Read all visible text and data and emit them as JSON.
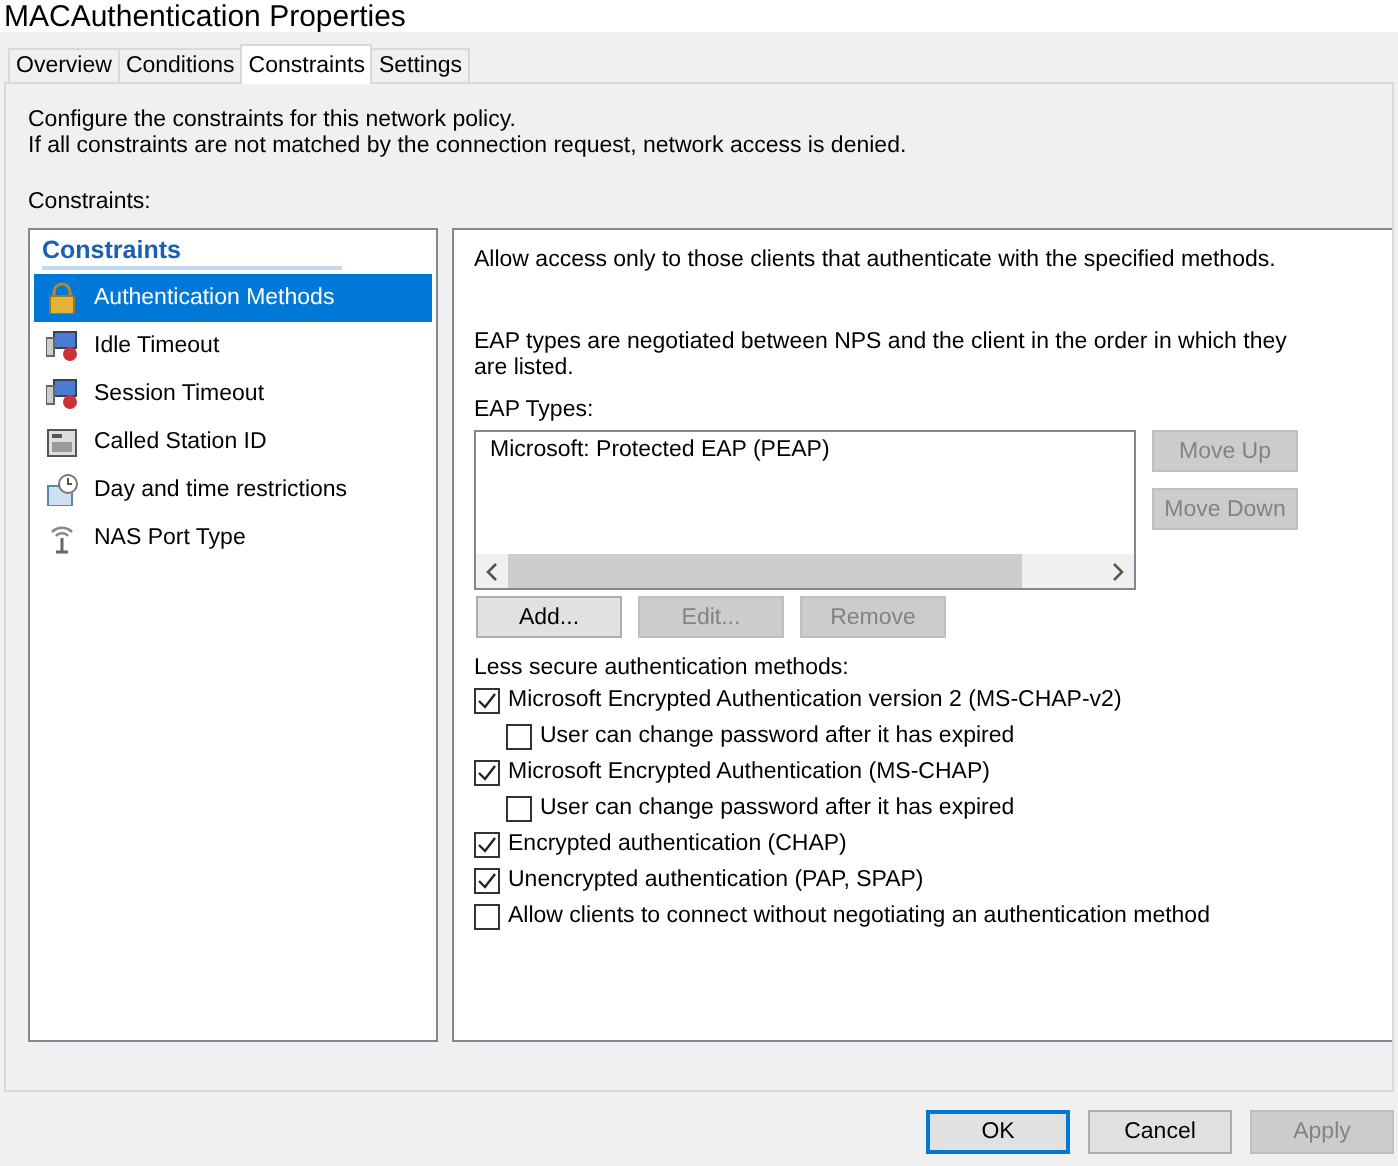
{
  "window": {
    "title": "MACAuthentication Properties"
  },
  "tabs": [
    {
      "label": "Overview",
      "selected": false
    },
    {
      "label": "Conditions",
      "selected": false
    },
    {
      "label": "Constraints",
      "selected": true
    },
    {
      "label": "Settings",
      "selected": false
    }
  ],
  "intro": [
    "Configure the constraints for this network policy.",
    "If all constraints are not matched by the connection request, network access is denied."
  ],
  "constraints_label": "Constraints:",
  "sidebar": {
    "heading": "Constraints",
    "items": [
      {
        "label": "Authentication Methods",
        "selected": true
      },
      {
        "label": "Idle Timeout",
        "selected": false
      },
      {
        "label": "Session Timeout",
        "selected": false
      },
      {
        "label": "Called Station ID",
        "selected": false
      },
      {
        "label": "Day and time restrictions",
        "selected": false
      },
      {
        "label": "NAS Port Type",
        "selected": false
      }
    ]
  },
  "panel": {
    "description": "Allow access only to those clients that authenticate with the specified methods.",
    "eap_note": "EAP types are negotiated between NPS and the client in the order in which they are listed.",
    "eap_label": "EAP Types:",
    "eap_types": [
      "Microsoft: Protected EAP (PEAP)"
    ],
    "side_buttons": [
      {
        "label": "Move Up",
        "disabled": true
      },
      {
        "label": "Move Down",
        "disabled": true
      }
    ],
    "eap_buttons": [
      {
        "label": "Add...",
        "disabled": false
      },
      {
        "label": "Edit...",
        "disabled": true
      },
      {
        "label": "Remove",
        "disabled": true
      }
    ],
    "methods_label": "Less secure authentication methods:",
    "methods": [
      {
        "label": "Microsoft Encrypted Authentication version 2 (MS-CHAP-v2)",
        "checked": true,
        "children": [
          {
            "label": "User can change password after it has expired",
            "checked": false
          }
        ]
      },
      {
        "label": "Microsoft Encrypted Authentication (MS-CHAP)",
        "checked": true,
        "children": [
          {
            "label": "User can change password after it has expired",
            "checked": false
          }
        ]
      },
      {
        "label": "Encrypted authentication (CHAP)",
        "checked": true
      },
      {
        "label": "Unencrypted authentication (PAP, SPAP)",
        "checked": true
      },
      {
        "label": "Allow clients to connect without negotiating an authentication method",
        "checked": false
      }
    ]
  },
  "footer_buttons": [
    {
      "label": "OK",
      "disabled": false,
      "default": true
    },
    {
      "label": "Cancel",
      "disabled": false,
      "default": false
    },
    {
      "label": "Apply",
      "disabled": true,
      "default": false
    }
  ]
}
